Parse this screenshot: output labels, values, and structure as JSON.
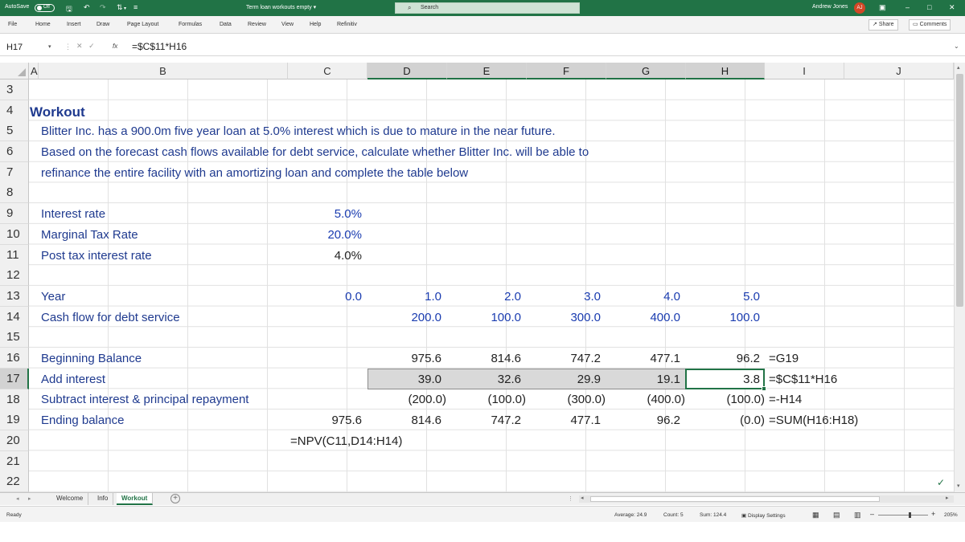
{
  "titlebar": {
    "autosave_label": "AutoSave",
    "autosave_state": "Off",
    "doc_title": "Term loan workouts empty",
    "doc_title_caret": "▾",
    "search_placeholder": "Search",
    "user_name": "Andrew Jones",
    "user_initials": "AJ"
  },
  "menu": {
    "tabs": [
      "File",
      "Home",
      "Insert",
      "Draw",
      "Page Layout",
      "Formulas",
      "Data",
      "Review",
      "View",
      "Help",
      "Refinitiv"
    ],
    "share_label": "Share",
    "comments_label": "Comments"
  },
  "formula_bar": {
    "name_box": "H17",
    "fx": "fx",
    "formula": "=$C$11*H16"
  },
  "columns": [
    "A",
    "B",
    "C",
    "D",
    "E",
    "F",
    "G",
    "H",
    "I",
    "J"
  ],
  "rows": [
    "3",
    "4",
    "5",
    "6",
    "7",
    "8",
    "9",
    "10",
    "11",
    "12",
    "13",
    "14",
    "15",
    "16",
    "17",
    "18",
    "19",
    "20",
    "21",
    "22"
  ],
  "sheet": {
    "title": "Workout",
    "desc1": "Blitter Inc. has a 900.0m five year loan at 5.0% interest which is due to mature in the near future.",
    "desc2": "Based on the forecast cash flows available for debt service, calculate whether Blitter Inc. will be able to",
    "desc3": "refinance the entire facility with an amortizing loan and complete the table below",
    "interest_label": "Interest rate",
    "interest_value": "5.0%",
    "tax_label": "Marginal Tax Rate",
    "tax_value": "20.0%",
    "post_tax_label": "Post tax interest rate",
    "post_tax_value": "4.0%",
    "year_label": "Year",
    "years": [
      "0.0",
      "1.0",
      "2.0",
      "3.0",
      "4.0",
      "5.0"
    ],
    "cashflow_label": "Cash flow for debt service",
    "cashflows": [
      "200.0",
      "100.0",
      "300.0",
      "400.0",
      "100.0"
    ],
    "beginning_label": "Beginning Balance",
    "beginning": [
      "975.6",
      "814.6",
      "747.2",
      "477.1",
      "96.2"
    ],
    "beginning_note": "=G19",
    "interest_row_label": "Add interest",
    "interest_row": [
      "39.0",
      "32.6",
      "29.9",
      "19.1",
      "3.8"
    ],
    "interest_note": "=$C$11*H16",
    "repay_label": "Subtract interest & principal repayment",
    "repay": [
      "(200.0)",
      "(100.0)",
      "(300.0)",
      "(400.0)",
      "(100.0)"
    ],
    "repay_note": "=-H14",
    "ending_label": "Ending balance",
    "ending_c": "975.6",
    "ending": [
      "814.6",
      "747.2",
      "477.1",
      "96.2",
      "(0.0)"
    ],
    "ending_note": "=SUM(H16:H18)",
    "npv_note": "=NPV(C11,D14:H14)"
  },
  "sheet_tabs": [
    "Welcome",
    "Info",
    "Workout"
  ],
  "status": {
    "ready": "Ready",
    "average": "Average: 24.9",
    "count": "Count: 5",
    "sum": "Sum: 124.4",
    "display_settings": "Display Settings",
    "zoom": "205%"
  }
}
